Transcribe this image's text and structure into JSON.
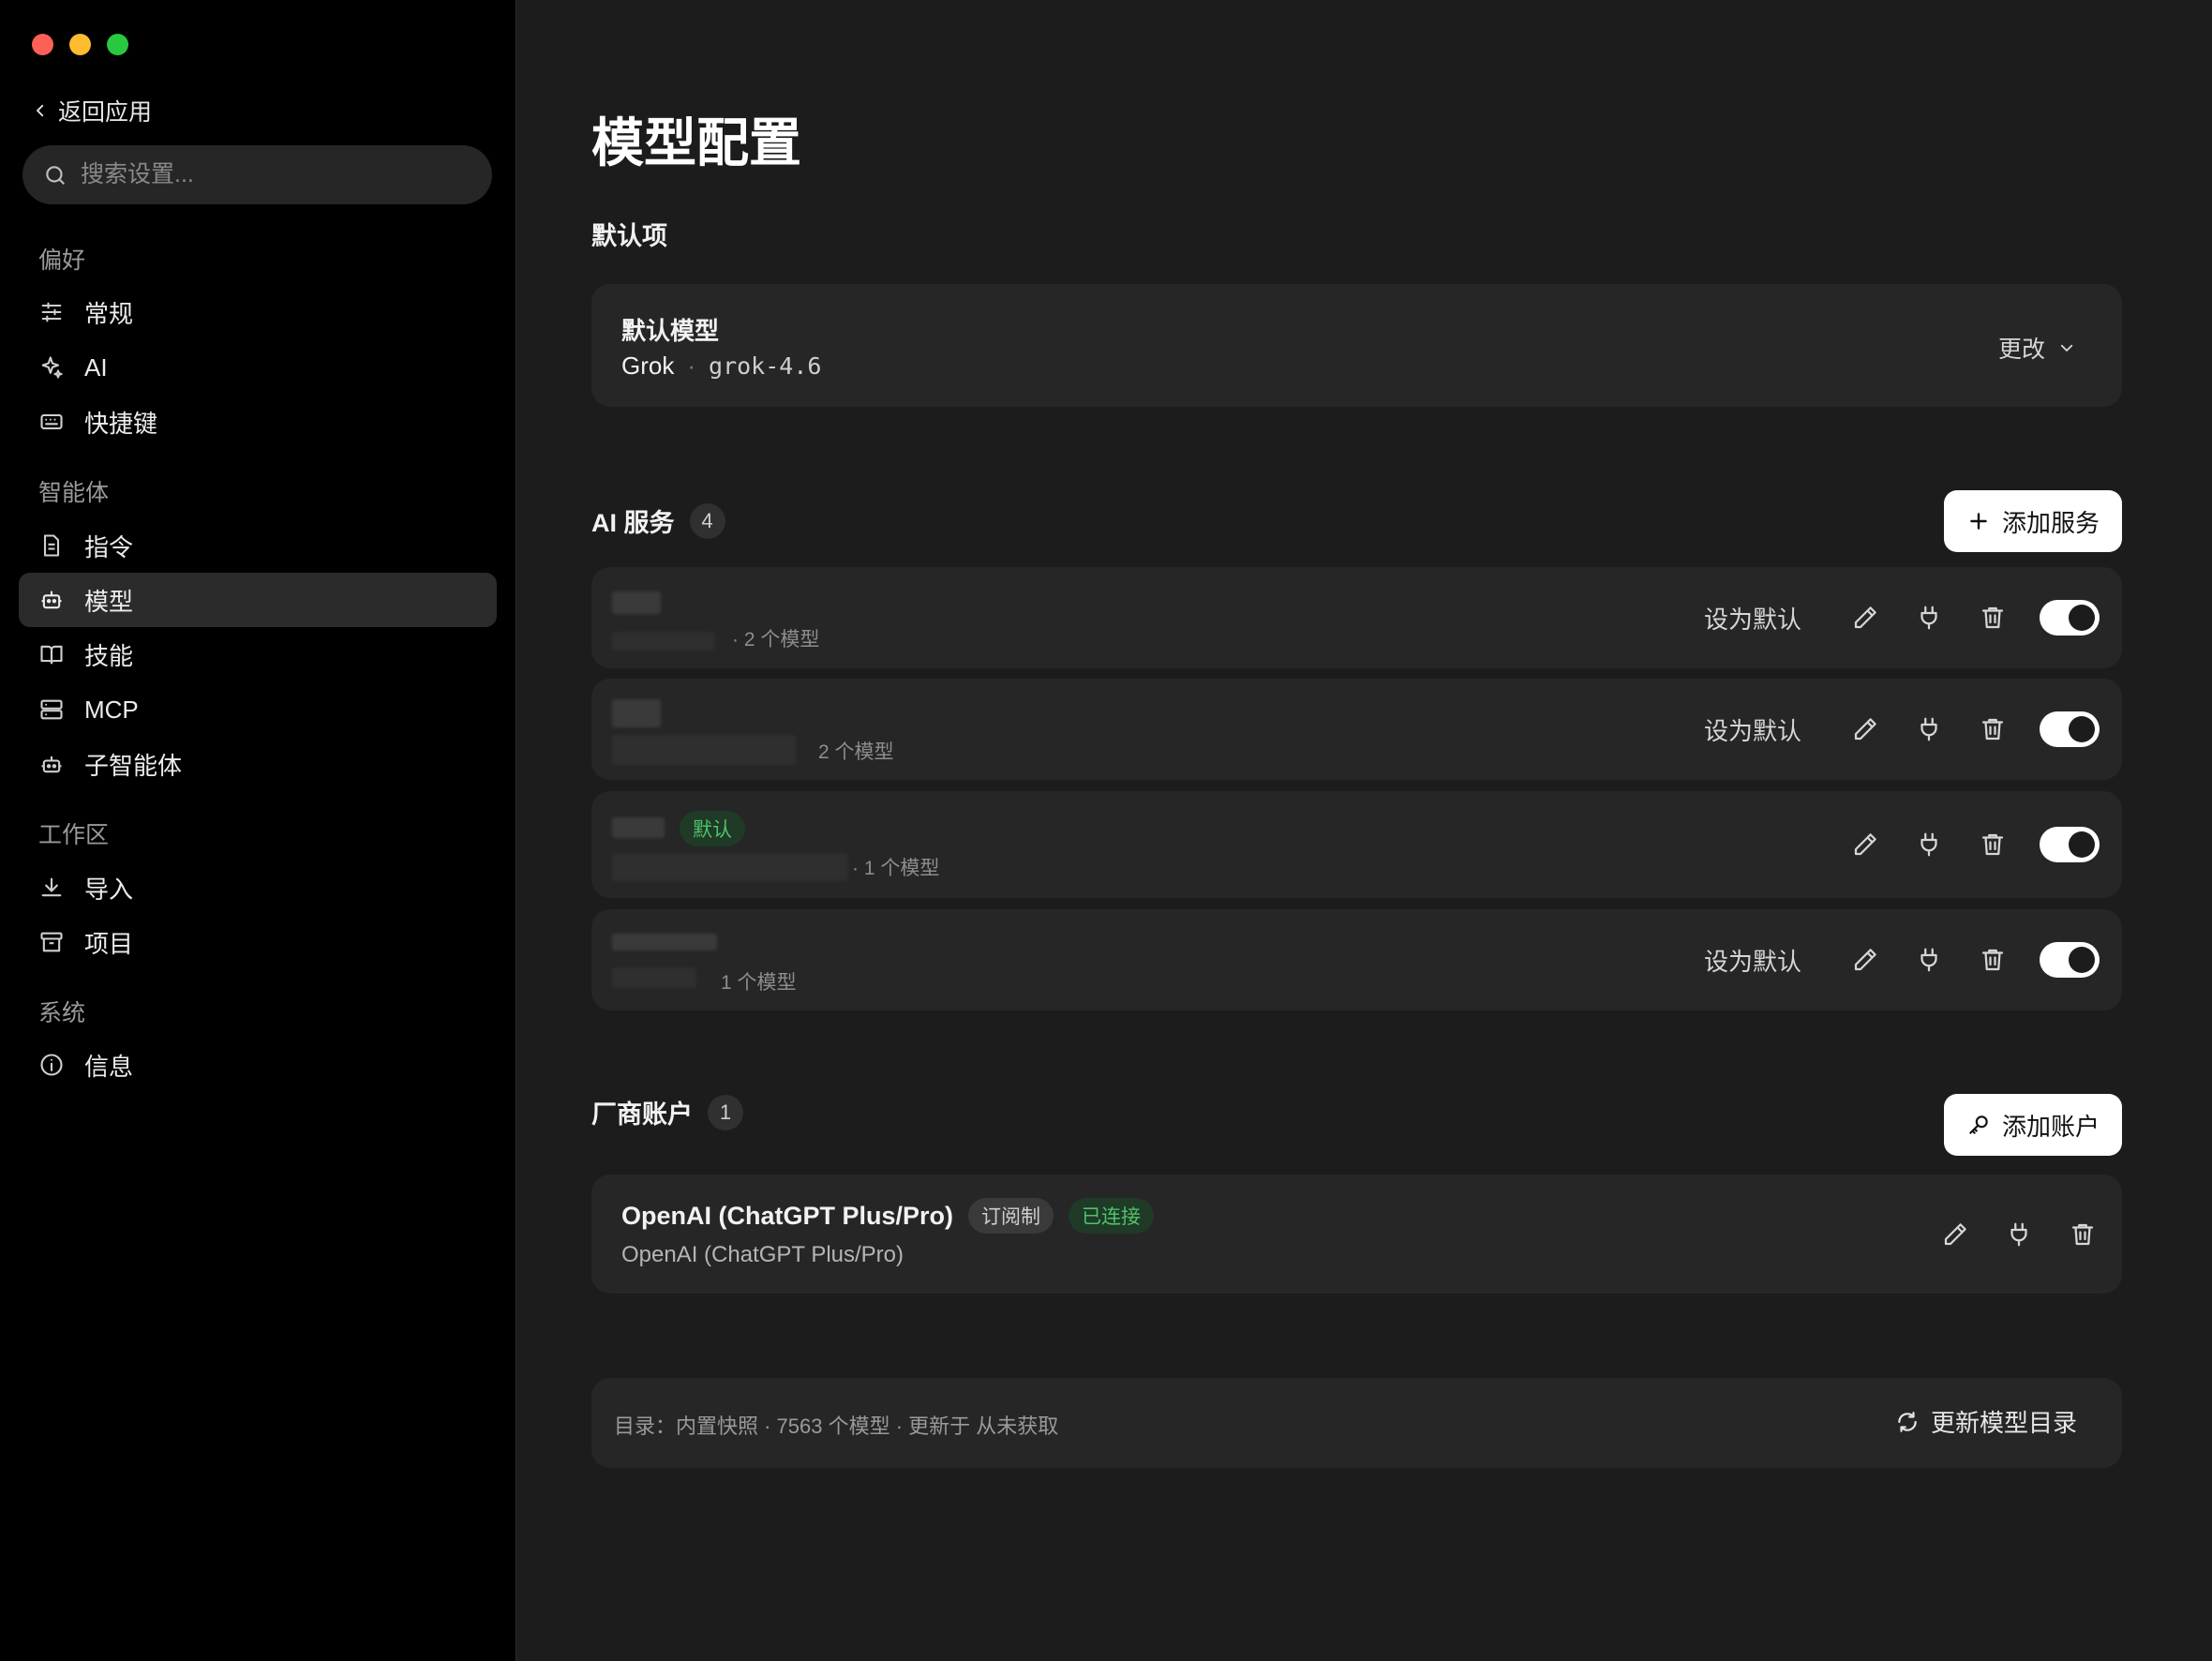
{
  "sidebar": {
    "back_label": "返回应用",
    "search_placeholder": "搜索设置...",
    "sections": [
      {
        "title": "偏好",
        "items": [
          {
            "label": "常规",
            "icon": "sliders-icon"
          },
          {
            "label": "AI",
            "icon": "sparkles-icon"
          },
          {
            "label": "快捷键",
            "icon": "keyboard-icon"
          }
        ]
      },
      {
        "title": "智能体",
        "items": [
          {
            "label": "指令",
            "icon": "document-icon"
          },
          {
            "label": "模型",
            "icon": "robot-icon",
            "active": true
          },
          {
            "label": "技能",
            "icon": "book-icon"
          },
          {
            "label": "MCP",
            "icon": "server-icon"
          },
          {
            "label": "子智能体",
            "icon": "bot-icon"
          }
        ]
      },
      {
        "title": "工作区",
        "items": [
          {
            "label": "导入",
            "icon": "download-icon"
          },
          {
            "label": "项目",
            "icon": "archive-icon"
          }
        ]
      },
      {
        "title": "系统",
        "items": [
          {
            "label": "信息",
            "icon": "info-icon"
          }
        ]
      }
    ]
  },
  "main": {
    "title": "模型配置",
    "defaults": {
      "heading": "默认项",
      "card_title": "默认模型",
      "provider": "Grok",
      "separator": "·",
      "model_id": "grok-4.6",
      "change_label": "更改"
    },
    "services": {
      "heading": "AI 服务",
      "count": "4",
      "add_label": "添加服务",
      "set_default_label": "设为默认",
      "default_badge": "默认",
      "rows": [
        {
          "meta": "· 2 个模型",
          "is_default": false,
          "enabled": true
        },
        {
          "meta": "2 个模型",
          "is_default": false,
          "enabled": true
        },
        {
          "meta": "· 1 个模型",
          "is_default": true,
          "enabled": true
        },
        {
          "meta": "1 个模型",
          "is_default": false,
          "enabled": true
        }
      ]
    },
    "vendors": {
      "heading": "厂商账户",
      "count": "1",
      "add_label": "添加账户",
      "account": {
        "name": "OpenAI (ChatGPT Plus/Pro)",
        "badge_subscription": "订阅制",
        "badge_connected": "已连接",
        "subtitle": "OpenAI (ChatGPT Plus/Pro)"
      }
    },
    "catalog": {
      "text": "目录：内置快照 · 7563 个模型 · 更新于 从未获取",
      "refresh_label": "更新模型目录"
    }
  },
  "colors": {
    "accent_green": "#4fc26b",
    "background": "#1c1c1c",
    "card": "#262626",
    "sidebar": "#000000"
  }
}
